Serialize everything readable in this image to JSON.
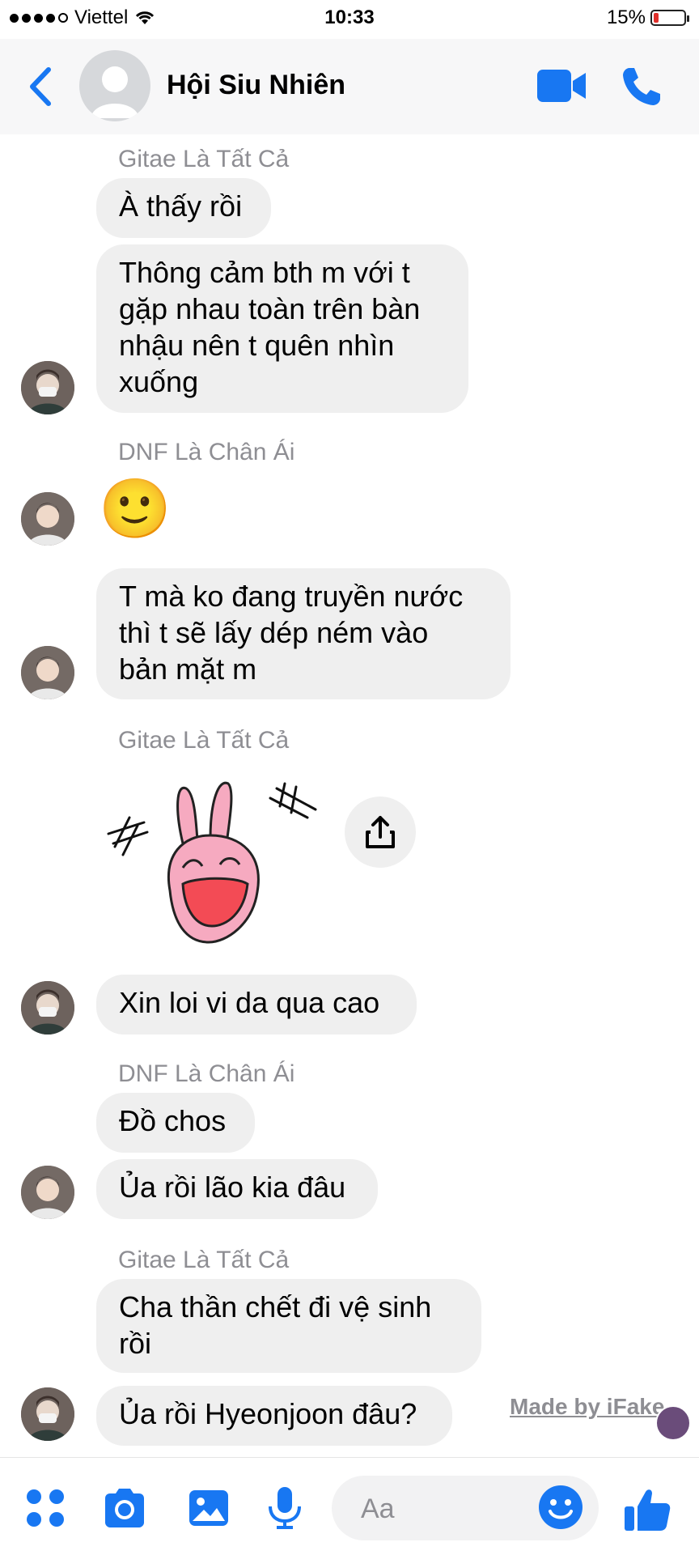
{
  "status_bar": {
    "carrier": "Viettel",
    "time": "10:33",
    "battery": "15%",
    "battery_level": 0.15,
    "signal_bars": 4
  },
  "header": {
    "title": "Hội Siu Nhiên"
  },
  "messages": {
    "sender1": "Gitae Là Tất Cả",
    "msg1": "À thấy rồi",
    "msg2": "Thông cảm bth m với t\ngặp nhau toàn trên bàn\nnhậu nên t quên nhìn\nxuống",
    "sender2": "DNF Là Chân Ái",
    "emoji": "🙂",
    "msg3": "T mà ko đang truyền nước\nthì t sẽ lấy dép ném vào\nbản mặt m",
    "sender3": "Gitae Là Tất Cả",
    "msg4": "Xin loi vi da qua cao",
    "sender4": "DNF Là Chân Ái",
    "msg5": "Đồ chos",
    "msg6": "Ủa rồi lão kia đâu",
    "sender5": "Gitae Là Tất Cả",
    "msg7": "Cha thần chết đi vệ sinh\nrồi",
    "msg8": "Ủa rồi Hyeonjoon đâu?"
  },
  "watermark": "Made by iFake",
  "composer": {
    "placeholder": "Aa"
  },
  "colors": {
    "accent": "#1877f2",
    "bubble": "#efefef",
    "sender_text": "#8e8e93"
  },
  "icons": [
    "back-icon",
    "video-call-icon",
    "phone-icon",
    "share-icon",
    "apps-icon",
    "camera-icon",
    "gallery-icon",
    "microphone-icon",
    "smile-icon",
    "like-icon"
  ]
}
